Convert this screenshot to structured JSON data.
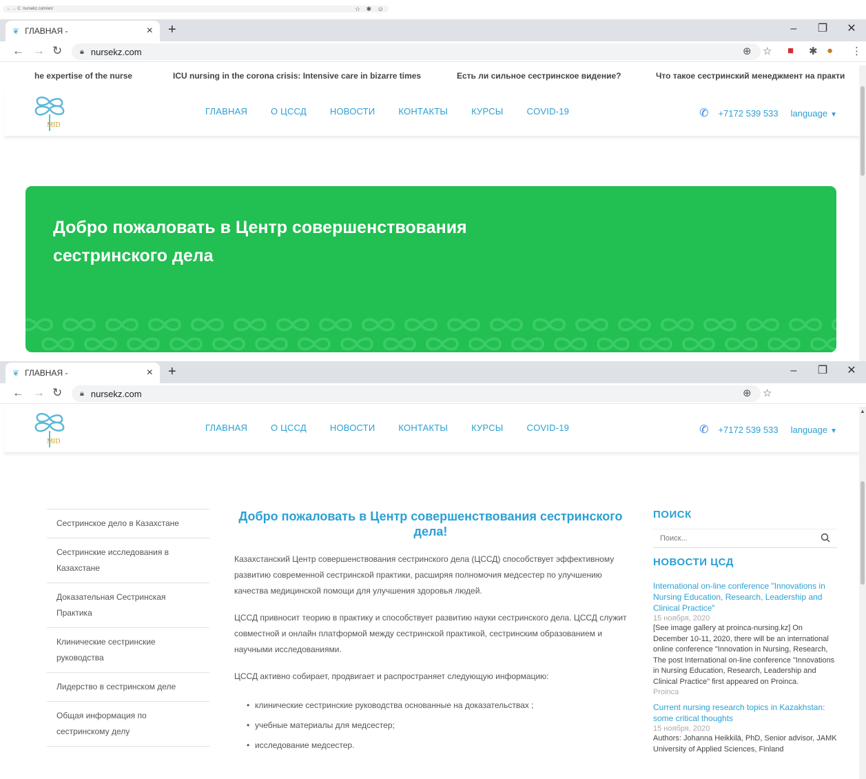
{
  "mini_strip": {
    "url": "nursekz.com/en/"
  },
  "browser": {
    "tab_title": "ГЛАВНАЯ -",
    "url": "nursekz.com"
  },
  "ticker": [
    "he expertise of the nurse",
    "ICU nursing in the corona crisis: Intensive care in bizarre times",
    "Есть ли сильное сестринское видение?",
    "Что такое сестринский менеджмент на практи"
  ],
  "header": {
    "logo_text": "MID",
    "nav": [
      "ГЛАВНАЯ",
      "О ЦССД",
      "НОВОСТИ",
      "КОНТАКТЫ",
      "КУРСЫ",
      "COVID-19"
    ],
    "phone": "+7172 539 533",
    "language": "language"
  },
  "banner": {
    "title": "Добро пожаловать в Центр совершенствования сестринского дела"
  },
  "left_menu": [
    "Сестринское дело в Казахстане",
    "Сестринские исследования в Казахстане",
    "Доказательная Сестринская Практика",
    "Клинические сестринские руководства",
    "Лидерство в сестринском деле",
    "Общая информация по сестринскому делу"
  ],
  "main": {
    "title": "Добро пожаловать в Центр совершенствования сестринского дела!",
    "paragraphs": [
      "Казахстанский Центр совершенствования сестринского дела (ЦССД) способствует эффективному развитию современной сестринской практики, расширяя полномочия медсестер по улучшению качества медицинской помощи для улучшения здоровья людей.",
      "ЦССД привносит теорию в практику и способствует развитию науки сестринского дела. ЦССД служит совместной и онлайн платформой между сестринской практикой, сестринским образованием и научными исследованиями.",
      "ЦССД активно собирает, продвигает и распространяет следующую информацию:"
    ],
    "bullets": [
      "клинические сестринские руководства основанные на доказательствах ;",
      "учебные материалы для медсестер;",
      "исследование медсестер."
    ]
  },
  "sidebar": {
    "search_heading": "ПОИСК",
    "search_placeholder": "Поиск...",
    "news_heading": "НОВОСТИ ЦСД",
    "news": [
      {
        "title": "International on-line conference \"Innovations in Nursing Education, Research, Leadership and Clinical Practice\"",
        "date": "15 ноября, 2020",
        "text": "[See image gallery at proinca-nursing.kz] On December 10-11, 2020, there will be an international online conference \"Innovation in Nursing, Research, The post International on-line conference \"Innovations in Nursing Education, Research, Leadership and Clinical Practice\" first appeared on Proinca.",
        "source": "Proinca"
      },
      {
        "title": "Current nursing research topics in Kazakhstan: some critical thoughts",
        "date": "15 ноября, 2020",
        "text": "Authors: Johanna Heikkilä, PhD, Senior advisor, JAMK University of Applied Sciences, Finland",
        "source": ""
      }
    ]
  },
  "colors": {
    "accent": "#2aa0d4",
    "banner_green": "#22bf52",
    "text_gray": "#555555"
  }
}
